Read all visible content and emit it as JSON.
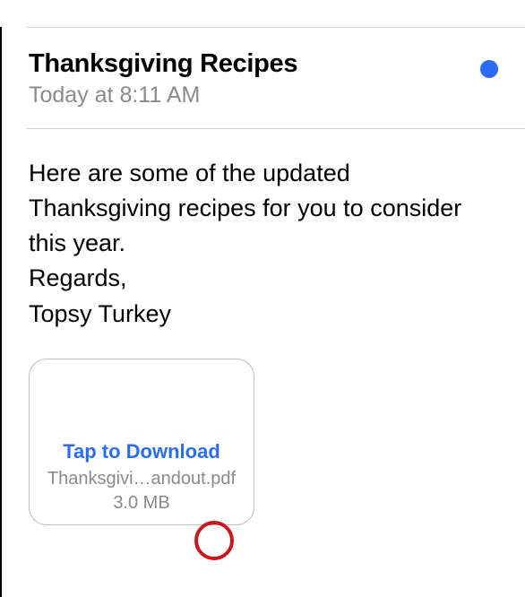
{
  "header": {
    "subject": "Thanksgiving Recipes",
    "timestamp": "Today at 8:11 AM"
  },
  "body": {
    "line1": "Here are some of the updated Thanksgiving recipes for you to consider this year.",
    "line2": "Regards,",
    "line3": "Topsy Turkey"
  },
  "attachment": {
    "tap_label": "Tap to Download",
    "filename": "Thanksgivi…andout.pdf",
    "filesize": "3.0 MB"
  },
  "colors": {
    "accent": "#2a6df4",
    "annotation": "#c8171d"
  }
}
